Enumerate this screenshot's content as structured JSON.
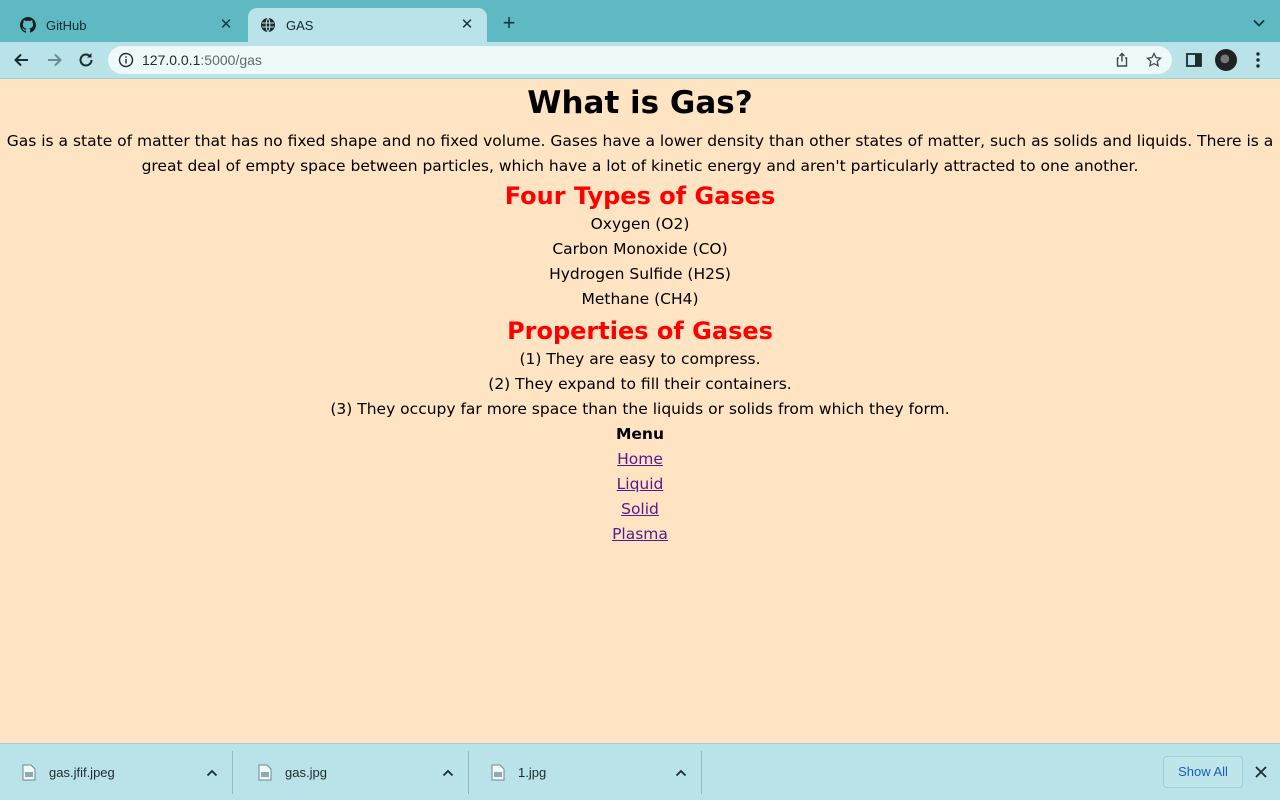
{
  "browser": {
    "tabs": [
      {
        "title": "GitHub",
        "icon": "github-icon",
        "active": false
      },
      {
        "title": "GAS",
        "icon": "globe-icon",
        "active": true
      }
    ],
    "url_host": "127.0.0.1",
    "url_rest": ":5000/gas"
  },
  "page": {
    "title": "What is Gas?",
    "intro": "Gas is a state of matter that has no fixed shape and no fixed volume. Gases have a lower density than other states of matter, such as solids and liquids. There is a great deal of empty space between particles, which have a lot of kinetic energy and aren't particularly attracted to one another.",
    "types_heading": "Four Types of Gases",
    "types": [
      "Oxygen (O2)",
      "Carbon Monoxide (CO)",
      "Hydrogen Sulfide (H2S)",
      "Methane (CH4)"
    ],
    "properties_heading": "Properties of Gases",
    "properties": [
      "(1) They are easy to compress.",
      "(2) They expand to fill their containers.",
      "(3) They occupy far more space than the liquids or solids from which they form."
    ],
    "menu_title": "Menu",
    "menu_links": [
      "Home",
      "Liquid",
      "Solid",
      "Plasma"
    ]
  },
  "downloads": {
    "items": [
      "gas.jfif.jpeg",
      "gas.jpg",
      "1.jpg"
    ],
    "show_all": "Show All"
  },
  "colors": {
    "page_background": "#ffe4c4",
    "heading_red": "#ff0000",
    "link_visited": "#551a8b",
    "browser_frame": "#5fb9c3",
    "toolbar": "#b9e3e8"
  }
}
